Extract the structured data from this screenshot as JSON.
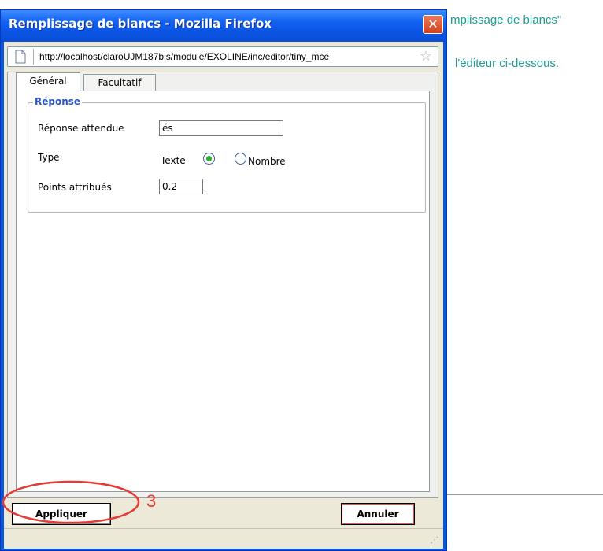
{
  "background_page": {
    "line1": "mplissage de blancs\"",
    "line2": "l'éditeur ci-dessous."
  },
  "window": {
    "title": "Remplissage de blancs - Mozilla Firefox",
    "close_glyph": "✕",
    "url": "http://localhost/claroUJM187bis/module/EXOLINE/inc/editor/tiny_mce"
  },
  "tabs": [
    {
      "label": "Général",
      "active": true
    },
    {
      "label": "Facultatif",
      "active": false
    }
  ],
  "reponse": {
    "legend": "Réponse",
    "expected_label": "Réponse attendue",
    "expected_value": "és",
    "type_label": "Type",
    "type_options": [
      {
        "label": "Texte",
        "checked": true
      },
      {
        "label": "Nombre",
        "checked": false
      }
    ],
    "points_label": "Points attribués",
    "points_value": "0.2"
  },
  "buttons": {
    "apply": "Appliquer",
    "cancel": "Annuler"
  },
  "annotation": {
    "step": "3",
    "color": "#e53935"
  },
  "colors": {
    "titlebar": "#0b54e3",
    "legend": "#2a56c6",
    "background_text": "#1e9c92"
  },
  "icons": [
    "page-icon",
    "bookmark-star-icon",
    "close-icon",
    "resize-grip-icon"
  ]
}
